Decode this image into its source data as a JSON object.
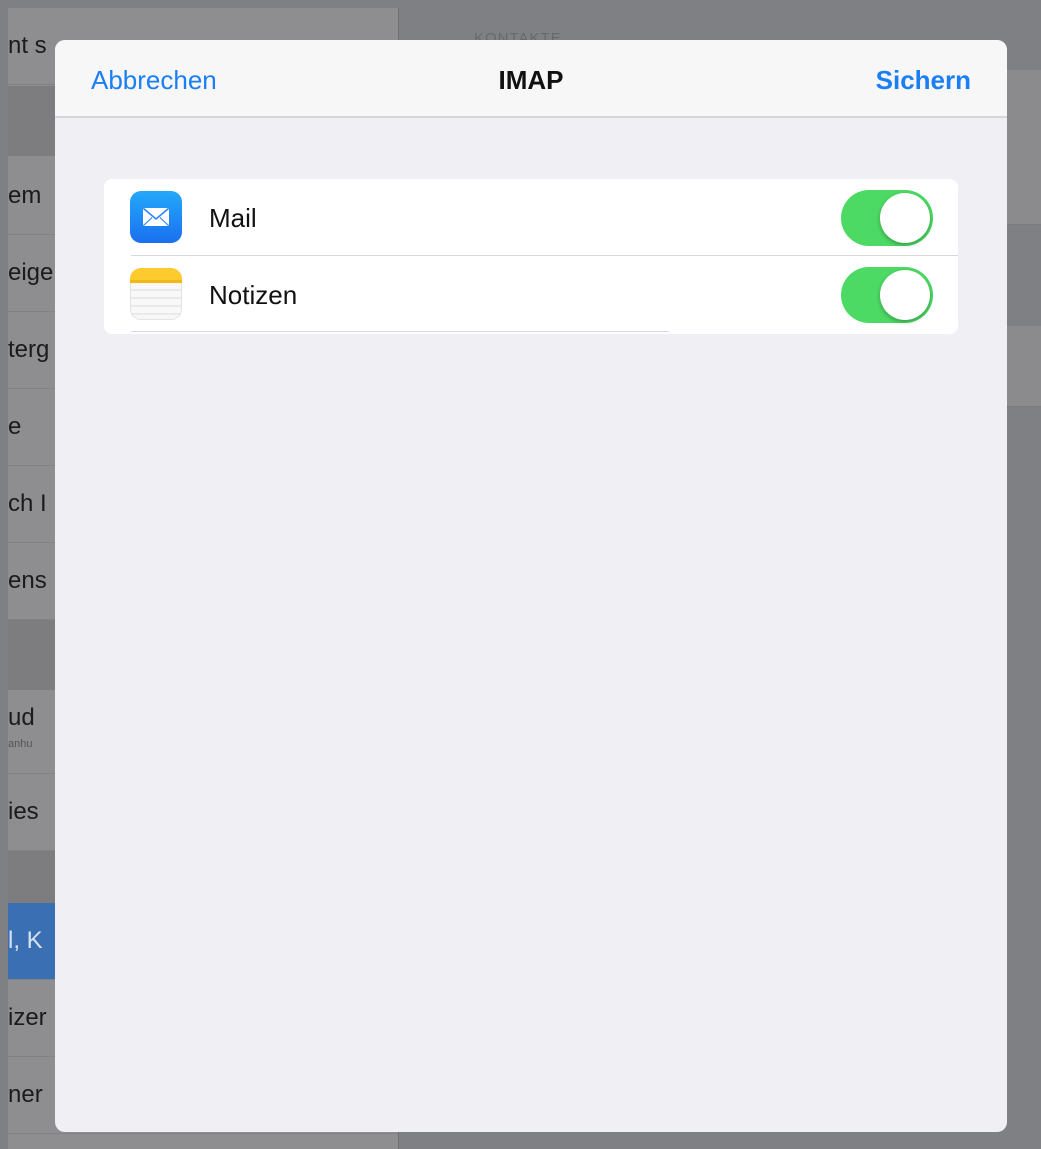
{
  "background": {
    "left_rows": [
      {
        "text": "nt s"
      },
      {
        "text": "em"
      },
      {
        "text": "eige"
      },
      {
        "text": "terg"
      },
      {
        "text": "e"
      },
      {
        "text": "ch I"
      },
      {
        "text": "ens"
      },
      {
        "text": "ud",
        "sub": "anhu"
      },
      {
        "text": "ies"
      },
      {
        "text": "l, K"
      },
      {
        "text": "izer"
      },
      {
        "text": "ner"
      }
    ],
    "right_header": "KONTAKTE"
  },
  "modal": {
    "navbar": {
      "cancel_label": "Abbrechen",
      "title": "IMAP",
      "save_label": "Sichern"
    },
    "items": [
      {
        "label": "Mail",
        "icon": "mail-icon",
        "enabled": true
      },
      {
        "label": "Notizen",
        "icon": "notes-icon",
        "enabled": true
      }
    ]
  },
  "colors": {
    "accent": "#1a7ef5",
    "toggle_on": "#4cd964",
    "selected_row": "#3b6fb3"
  }
}
